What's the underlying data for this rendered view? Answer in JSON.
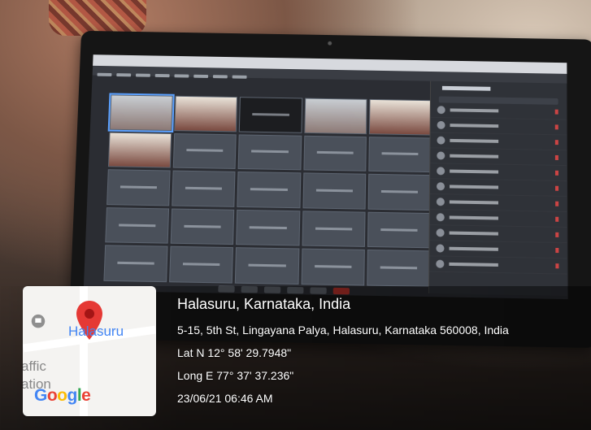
{
  "location": {
    "title": "Halasuru, Karnataka, India",
    "address": "5-15, 5th St, Lingayana Palya, Halasuru, Karnataka 560008, India",
    "lat": "Lat N 12° 58' 29.7948\"",
    "long": "Long E 77° 37' 37.236\"",
    "timestamp": "23/06/21 06:46 AM"
  },
  "map": {
    "place_label": "Halasuru",
    "traffic_label": "affic\nation",
    "logo": [
      "G",
      "o",
      "o",
      "g",
      "l",
      "e"
    ],
    "logo_colors": [
      "#4285f4",
      "#ea4335",
      "#fbbc05",
      "#4285f4",
      "#34a853",
      "#ea4335"
    ],
    "pin_color": "#e53935",
    "pin_icon": "map-pin-icon"
  }
}
